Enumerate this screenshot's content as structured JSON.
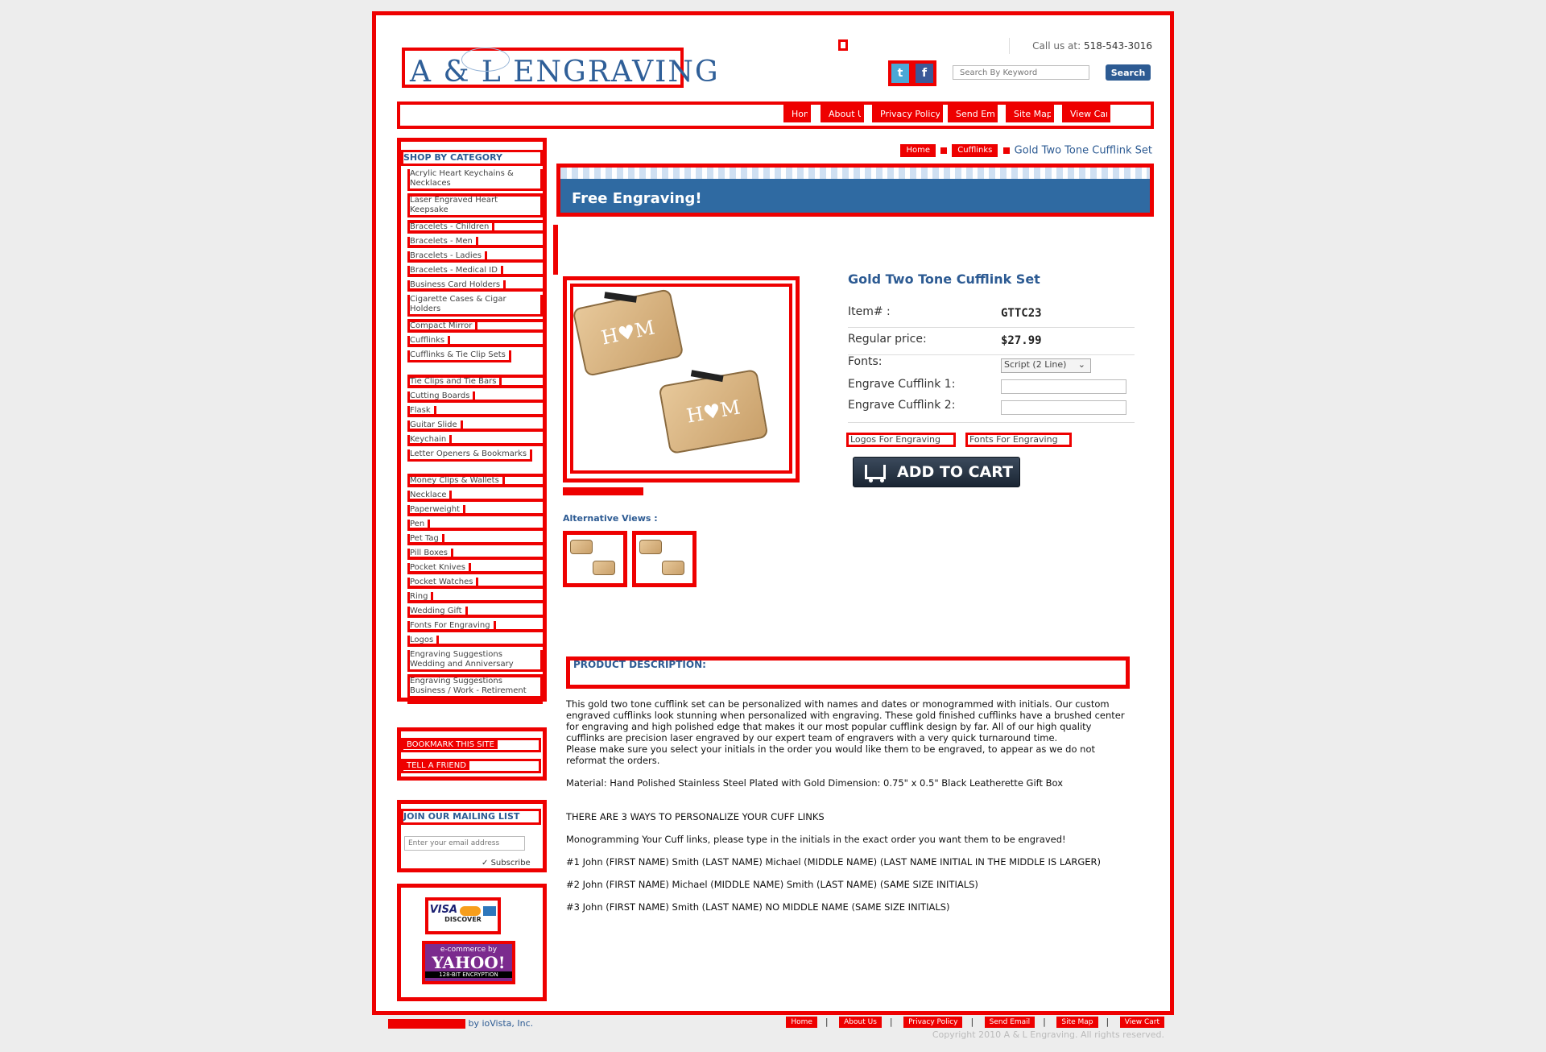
{
  "header": {
    "logo_text": "A & L ENGRAVING",
    "call_label": "Call us at:",
    "phone": "518-543-3016",
    "search_placeholder": "Search By Keyword",
    "search_button": "Search",
    "twitter_icon": "t",
    "facebook_icon": "f"
  },
  "topnav": [
    "Home",
    "About Us",
    "Privacy Policy",
    "Send Email",
    "Site Map",
    "View Cart"
  ],
  "sidebar": {
    "category_title": "SHOP BY CATEGORY",
    "categories": [
      "Acrylic Heart Keychains & Necklaces",
      "Laser Engraved Heart Keepsake",
      "Bracelets - Children",
      "Bracelets - Men",
      "Bracelets - Ladies",
      "Bracelets - Medical ID",
      "Business Card Holders",
      "Cigarette Cases & Cigar Holders",
      "Compact Mirror",
      "Cufflinks",
      "Cufflinks & Tie Clip Sets",
      "Tie Clips and Tie Bars",
      "Cutting Boards",
      "Flask",
      "Guitar Slide",
      "Keychain",
      "Letter Openers & Bookmarks",
      "Money Clips & Wallets",
      "Necklace",
      "Paperweight",
      "Pen",
      "Pet Tag",
      "Pill Boxes",
      "Pocket Knives",
      "Pocket Watches",
      "Ring",
      "Wedding Gift",
      "Fonts For Engraving",
      "Logos",
      "Engraving Suggestions Wedding and Anniversary",
      "Engraving Suggestions Business / Work - Retirement"
    ],
    "bookmark": "BOOKMARK THIS SITE",
    "tell_friend": "TELL A FRIEND",
    "mailing_title": "JOIN OUR MAILING LIST",
    "email_placeholder": "Enter your email address",
    "subscribe": "Subscribe",
    "cards": {
      "visa": "VISA",
      "discover": "DISCOVER"
    },
    "yahoo": {
      "small": "e-commerce by",
      "big": "YAHOO!",
      "enc": "128-BIT ENCRYPTION"
    }
  },
  "breadcrumb": {
    "home": "Home",
    "cat": "Cufflinks",
    "current": "Gold Two Tone Cufflink Set"
  },
  "banner": "Free Engraving!",
  "product": {
    "title": "Gold Two Tone Cufflink Set",
    "item_label": "Item# :",
    "item_value": "GTTC23",
    "price_label": "Regular price:",
    "price_value": "$27.99",
    "fonts_label": "Fonts:",
    "fonts_selected": "Script (2 Line)",
    "engrave1_label": "Engrave Cufflink 1:",
    "engrave2_label": "Engrave Cufflink 2:",
    "logos_link": "Logos For Engraving",
    "fonts_link": "Fonts For Engraving",
    "add_to_cart": "ADD TO CART",
    "monogram": "H♥M",
    "alt_views": "Alternative Views :"
  },
  "description": {
    "heading": "PRODUCT DESCRIPTION:",
    "p1": "This gold two tone cufflink set can be personalized with names and dates or monogrammed with initials. Our custom engraved cufflinks look stunning when personalized with engraving. These gold finished cufflinks have a brushed center for engraving and high polished edge that makes it our most popular cufflink design by far. All of our high quality cufflinks are precision laser engraved by our expert team of engravers with a very quick turnaround time.",
    "p2": "Please make sure you select your initials in the order you would like them to be engraved, to appear as we do not reformat the orders.",
    "p3": "Material: Hand Polished Stainless Steel Plated with Gold Dimension: 0.75\" x 0.5\" Black Leatherette Gift Box",
    "p4": "THERE ARE 3 WAYS TO PERSONALIZE YOUR CUFF LINKS",
    "p5": "Monogramming Your Cuff links, please type in the initials in the exact order you want them to be engraved!",
    "p6": "#1 John (FIRST NAME) Smith (LAST NAME) Michael (MIDDLE NAME) (LAST NAME INITIAL IN THE MIDDLE IS LARGER)",
    "p7": "#2 John (FIRST NAME) Michael (MIDDLE NAME) Smith (LAST NAME) (SAME SIZE INITIALS)",
    "p8": "#3 John (FIRST NAME) Smith (LAST NAME) NO MIDDLE NAME (SAME SIZE INITIALS)"
  },
  "footer": {
    "by": "by ioVista, Inc.",
    "links": [
      "Home",
      "About Us",
      "Privacy Policy",
      "Send Email",
      "Site Map",
      "View Cart"
    ],
    "copyright": "Copyright 2010 A & L Engraving. All rights reserved."
  }
}
